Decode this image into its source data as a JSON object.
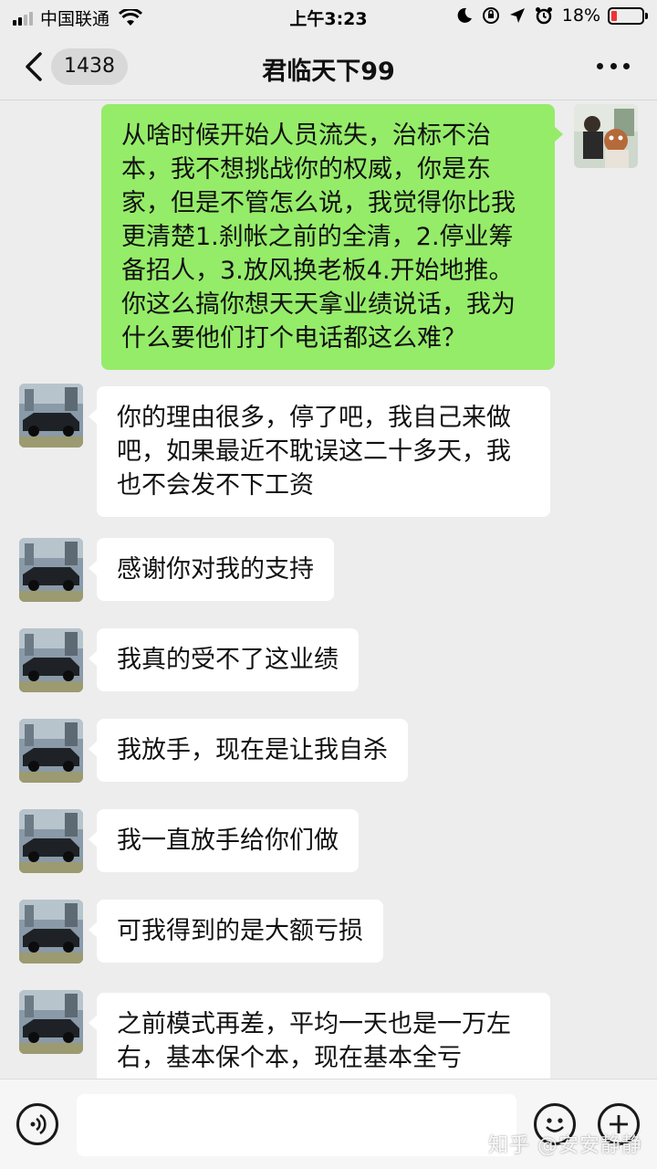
{
  "status_bar": {
    "carrier": "中国联通",
    "time": "上午3:23",
    "battery_percent": "18%",
    "battery_level": 0.18,
    "signal_bars_on": 2,
    "signal_bars_total": 4
  },
  "nav": {
    "unread_count": "1438",
    "title": "君临天下99",
    "more_icon": "more-dots-icon",
    "back_icon": "chevron-left-icon"
  },
  "messages": [
    {
      "direction": "out",
      "text": "从啥时候开始人员流失，治标不治本，我不想挑战你的权威，你是东家，但是不管怎么说，我觉得你比我更清楚1.刹帐之前的全清，2.停业筹备招人，3.放风换老板4.开始地推。你这么搞你想天天拿业绩说话，我为什么要他们打个电话都这么难？"
    },
    {
      "direction": "in",
      "text": "你的理由很多，停了吧，我自己来做吧，如果最近不耽误这二十多天，我也不会发不下工资"
    },
    {
      "direction": "in",
      "text": "感谢你对我的支持"
    },
    {
      "direction": "in",
      "text": "我真的受不了这业绩"
    },
    {
      "direction": "in",
      "text": "我放手，现在是让我自杀"
    },
    {
      "direction": "in",
      "text": "我一直放手给你们做"
    },
    {
      "direction": "in",
      "text": "可我得到的是大额亏损"
    },
    {
      "direction": "in",
      "text": "之前模式再差，平均一天也是一万左右，基本保个本，现在基本全亏"
    }
  ],
  "input_bar": {
    "voice_icon": "voice-icon",
    "emoji_icon": "emoji-icon",
    "plus_icon": "plus-icon",
    "watermark": "知乎 @安安静静"
  },
  "colors": {
    "background": "#ededed",
    "outgoing_bubble": "#95ec69",
    "incoming_bubble": "#ffffff",
    "battery_low": "#e33333"
  }
}
